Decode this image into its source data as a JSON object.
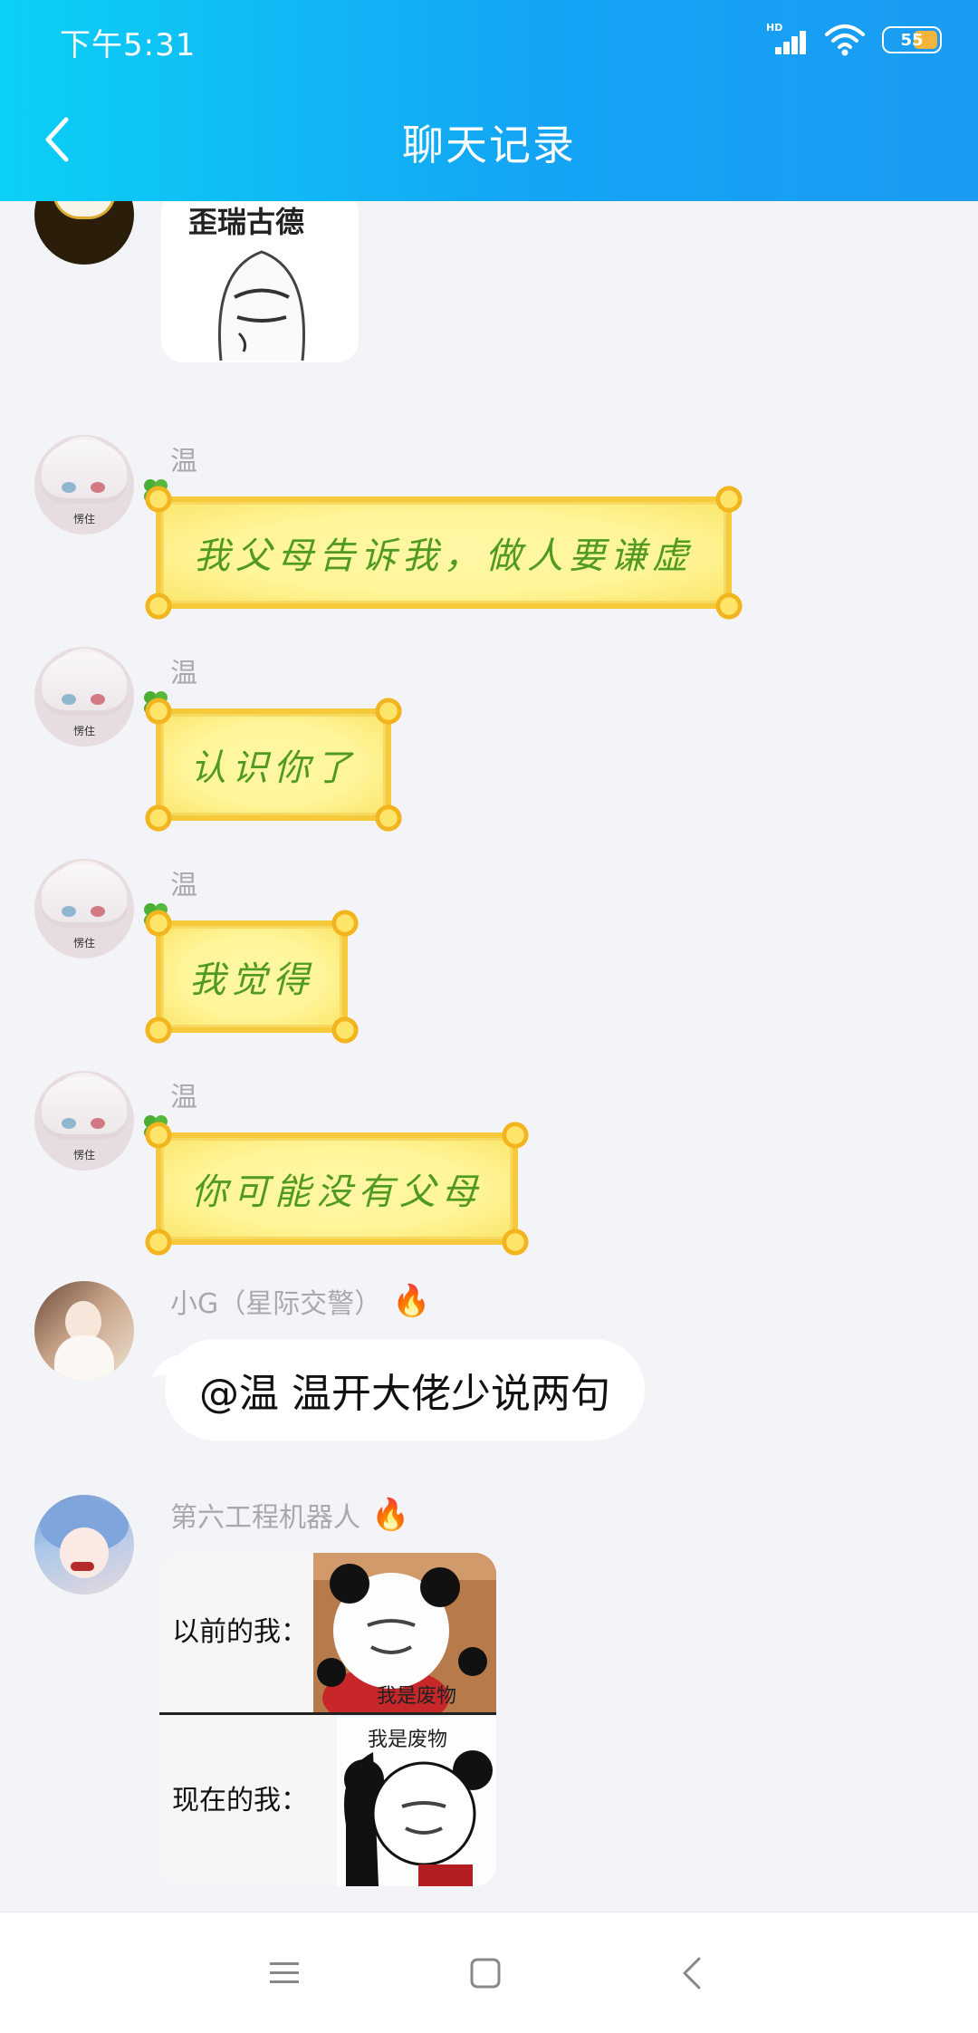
{
  "status_bar": {
    "time": "下午5:31",
    "signal_label": "HD",
    "battery": "55"
  },
  "header": {
    "title": "聊天记录"
  },
  "messages": [
    {
      "sender": "",
      "sticker_caption": "歪瑞古德"
    },
    {
      "sender": "温",
      "avatar_tag": "愣住",
      "text": "我父母告诉我，做人要谦虚"
    },
    {
      "sender": "温",
      "avatar_tag": "愣住",
      "text": "认识你了"
    },
    {
      "sender": "温",
      "avatar_tag": "愣住",
      "text": "我觉得"
    },
    {
      "sender": "温",
      "avatar_tag": "愣住",
      "text": "你可能没有父母"
    },
    {
      "sender": "小G（星际交警）",
      "badge": "🔥",
      "text": "@温 温开大佬少说两句"
    },
    {
      "sender": "第六工程机器人",
      "badge": "🔥",
      "meme": {
        "top_label": "以前的我：",
        "top_caption": "我是废物",
        "bottom_caption": "我是废物",
        "bottom_label": "现在的我："
      }
    }
  ],
  "colors": {
    "header_start": "#0bd0f6",
    "header_end": "#1a9cf2",
    "background": "#f3f4f8",
    "fancy_text": "#4f9a1f",
    "fancy_fill": "#fff59a",
    "fancy_border": "#f5c93a"
  },
  "nav": {
    "menu_icon": "menu-icon",
    "home_icon": "home-square-icon",
    "back_icon": "back-triangle-icon"
  }
}
